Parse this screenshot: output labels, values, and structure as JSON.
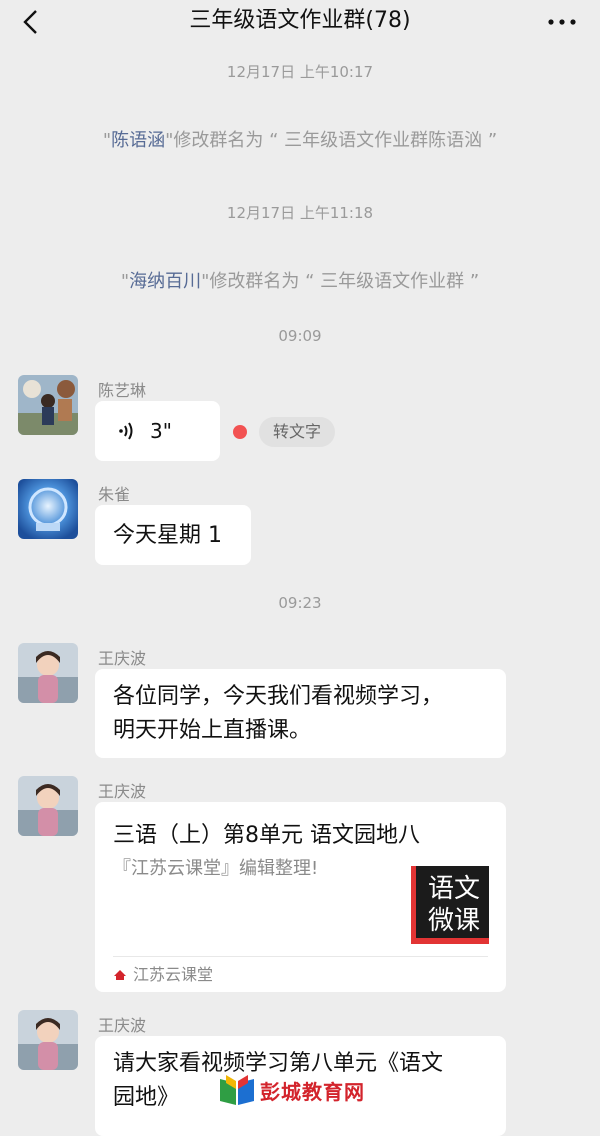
{
  "header": {
    "title": "三年级语文作业群(78)"
  },
  "messages": {
    "ts1": "12月17日 上午10:17",
    "sys1": {
      "quote_open": "\"",
      "name": "陈语涵",
      "text": "\"修改群名为 “ 三年级语文作业群陈语汹 ”"
    },
    "ts2": "12月17日 上午11:18",
    "sys2": {
      "quote_open": "\"",
      "name": "海纳百川",
      "text": "\"修改群名为 “ 三年级语文作业群 ”"
    },
    "ts3": "09:09",
    "m1": {
      "sender": "陈艺琳",
      "duration": "3\"",
      "convert_label": "转文字"
    },
    "m2": {
      "sender": "朱雀",
      "text": "今天星期 1"
    },
    "ts4": "09:23",
    "m3": {
      "sender": "王庆波",
      "line1": "各位同学，今天我们看视频学习，",
      "line2": "明天开始上直播课。"
    },
    "m4": {
      "sender": "王庆波",
      "card_title": "三语（上）第8单元 语文园地八",
      "card_desc": "『江苏云课堂』编辑整理!",
      "thumb_line1": "语文",
      "thumb_line2": "微课",
      "source": "江苏云课堂"
    },
    "m5": {
      "sender": "王庆波",
      "line1": "请大家看视频学习第八单元《语文",
      "line2": "园地》"
    }
  },
  "watermark": {
    "text": "彭城教育网"
  },
  "colors": {
    "background": "#ededed",
    "link_name": "#576b95",
    "red_dot": "#f25252",
    "watermark_red": "#d3242c"
  }
}
